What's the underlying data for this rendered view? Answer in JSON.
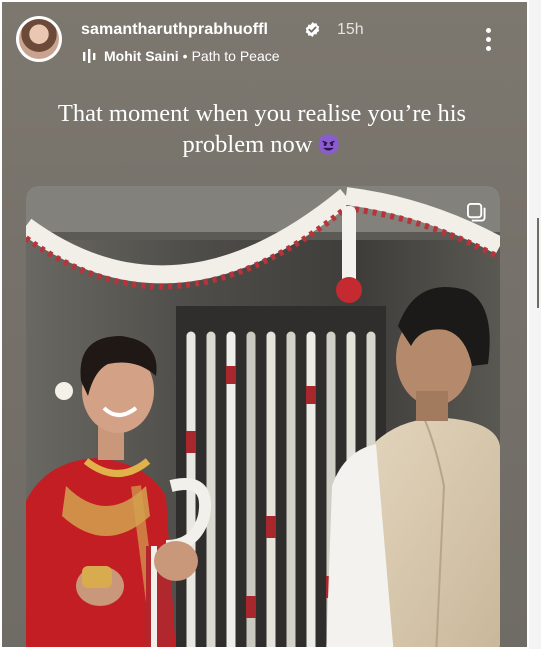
{
  "post": {
    "username": "samantharuthprabhuoffl",
    "time": "15h",
    "music": {
      "artist": "Mohit Saini",
      "separator": "•",
      "track": "Path to Peace"
    },
    "caption": "That moment when you realise you’re his problem now"
  },
  "icons": {
    "verified": "verified-badge-icon",
    "music": "music-bars-icon",
    "more": "more-vertical-icon",
    "emoji": "smiling-devil-emoji",
    "media": "multi-media-icon"
  },
  "colors": {
    "story_background": "#78736c",
    "emoji_purple": "#8a5bd1",
    "saree_red": "#c41e25"
  }
}
